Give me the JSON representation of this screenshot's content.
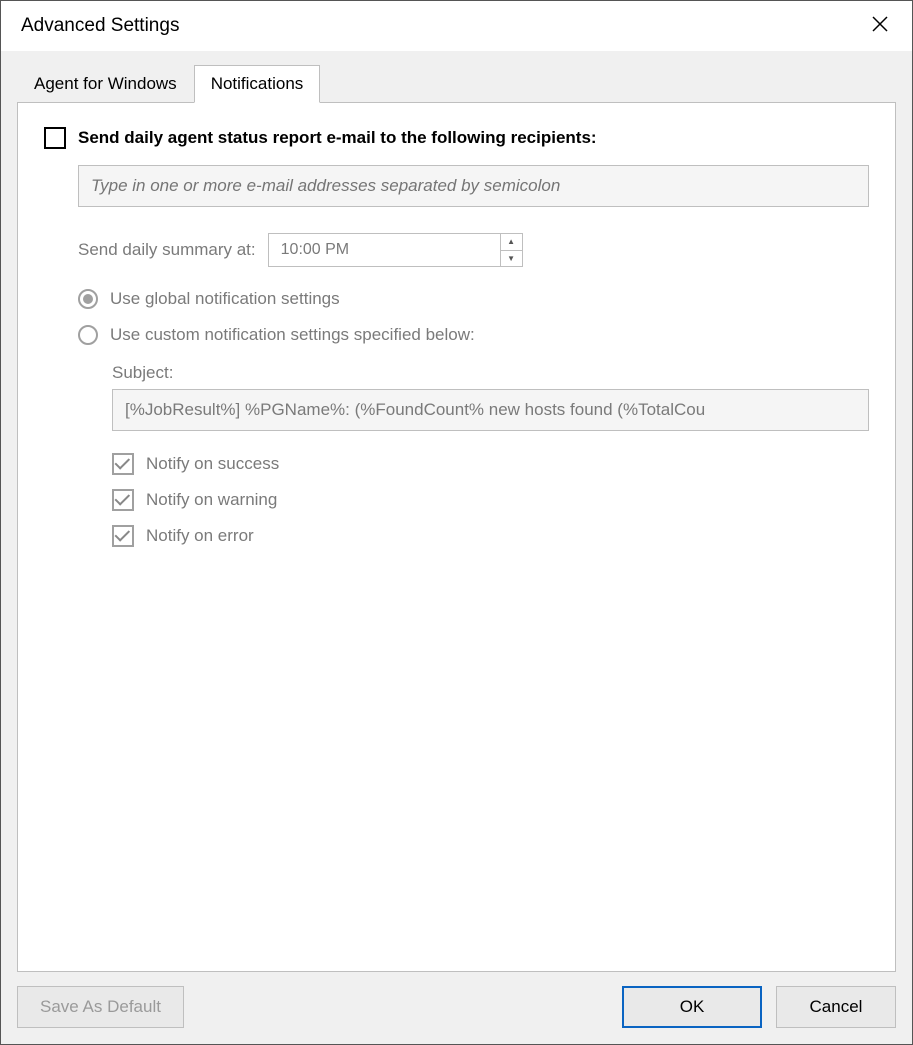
{
  "window": {
    "title": "Advanced Settings"
  },
  "tabs": {
    "agent": "Agent for Windows",
    "notifications": "Notifications"
  },
  "notifications": {
    "daily_report_label": "Send daily agent status report e-mail to the following recipients:",
    "email_placeholder": "Type in one or more e-mail addresses separated by semicolon",
    "summary_label": "Send daily summary at:",
    "summary_time": "10:00 PM",
    "radio_global": "Use global notification settings",
    "radio_custom": "Use custom notification settings specified below:",
    "subject_label": "Subject:",
    "subject_value": "[%JobResult%] %PGName%: (%FoundCount% new hosts found (%TotalCou",
    "notify_success": "Notify on success",
    "notify_warning": "Notify on warning",
    "notify_error": "Notify on error"
  },
  "buttons": {
    "save_default": "Save As Default",
    "ok": "OK",
    "cancel": "Cancel"
  }
}
